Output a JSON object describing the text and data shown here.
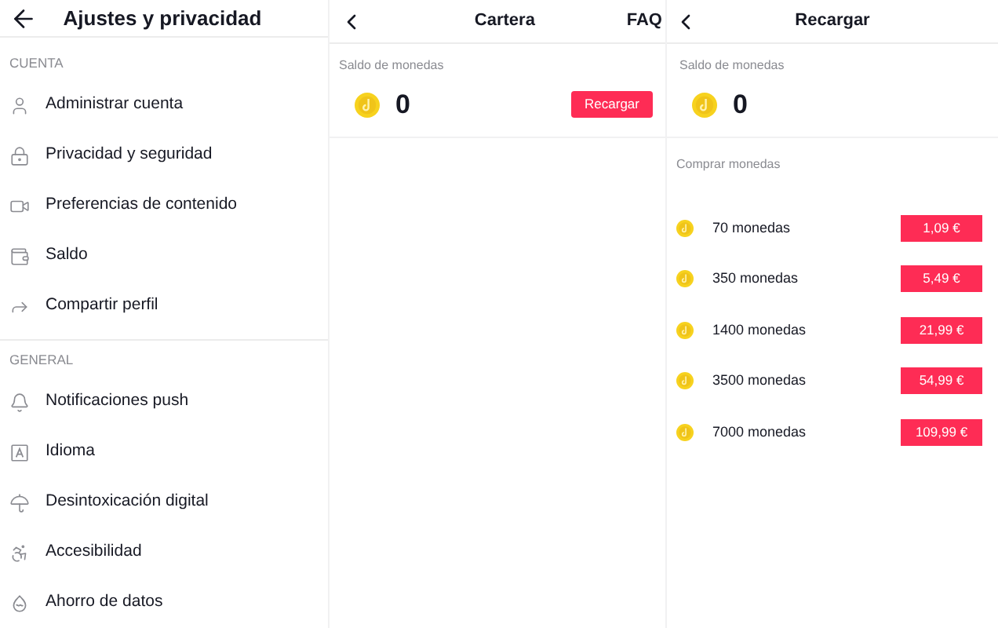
{
  "settings": {
    "title": "Ajustes y privacidad",
    "sections": [
      {
        "heading": "CUENTA",
        "items": [
          "Administrar cuenta",
          "Privacidad y seguridad",
          "Preferencias de contenido",
          "Saldo",
          "Compartir perfil"
        ]
      },
      {
        "heading": "GENERAL",
        "items": [
          "Notificaciones push",
          "Idioma",
          "Desintoxicación digital",
          "Accesibilidad",
          "Ahorro de datos"
        ]
      }
    ]
  },
  "wallet": {
    "title": "Cartera",
    "faq": "FAQ",
    "balance_label": "Saldo de monedas",
    "balance": "0",
    "button": "Recargar"
  },
  "recharge": {
    "title": "Recargar",
    "balance_label": "Saldo de monedas",
    "balance": "0",
    "buy_label": "Comprar monedas",
    "packages": [
      {
        "coins": "70 monedas",
        "price": "1,09 €"
      },
      {
        "coins": "350 monedas",
        "price": "5,49 €"
      },
      {
        "coins": "1400 monedas",
        "price": "21,99 €"
      },
      {
        "coins": "3500 monedas",
        "price": "54,99 €"
      },
      {
        "coins": "7000 monedas",
        "price": "109,99 €"
      }
    ]
  }
}
